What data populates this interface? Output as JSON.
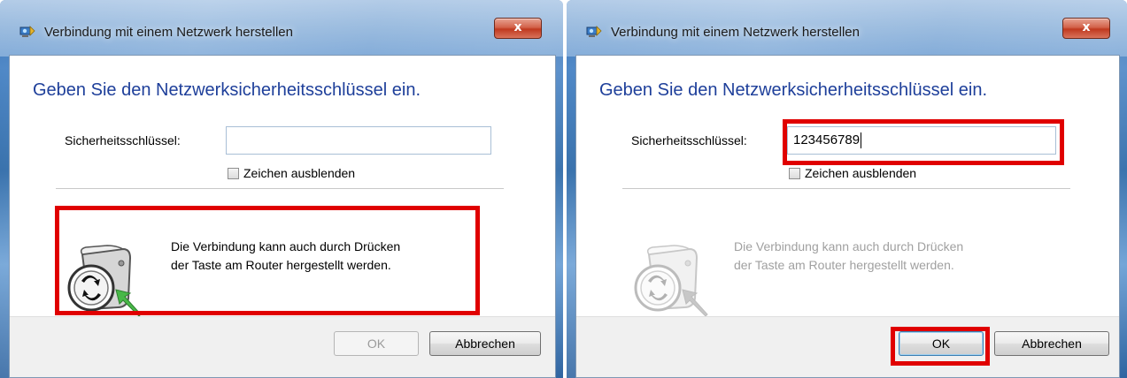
{
  "left": {
    "window_title": "Verbindung mit einem Netzwerk herstellen",
    "close_label": "x",
    "heading": "Geben Sie den Netzwerksicherheitsschlüssel ein.",
    "key_label": "Sicherheitsschlüssel:",
    "key_value": "",
    "hide_chars_label": "Zeichen ausblenden",
    "wps_line1": "Die Verbindung kann auch durch Drücken",
    "wps_line2": "der Taste am Router hergestellt werden.",
    "ok_label": "OK",
    "cancel_label": "Abbrechen"
  },
  "right": {
    "window_title": "Verbindung mit einem Netzwerk herstellen",
    "close_label": "x",
    "heading": "Geben Sie den Netzwerksicherheitsschlüssel ein.",
    "key_label": "Sicherheitsschlüssel:",
    "key_value": "123456789",
    "hide_chars_label": "Zeichen ausblenden",
    "wps_line1": "Die Verbindung kann auch durch Drücken",
    "wps_line2": "der Taste am Router hergestellt werden.",
    "ok_label": "OK",
    "cancel_label": "Abbrechen"
  },
  "colors": {
    "highlight": "#e00000",
    "heading": "#1e3f9a",
    "wps_arrow": "#48b848"
  },
  "icons": {
    "title": "network-connect-icon",
    "wps": "wps-router-icon"
  }
}
